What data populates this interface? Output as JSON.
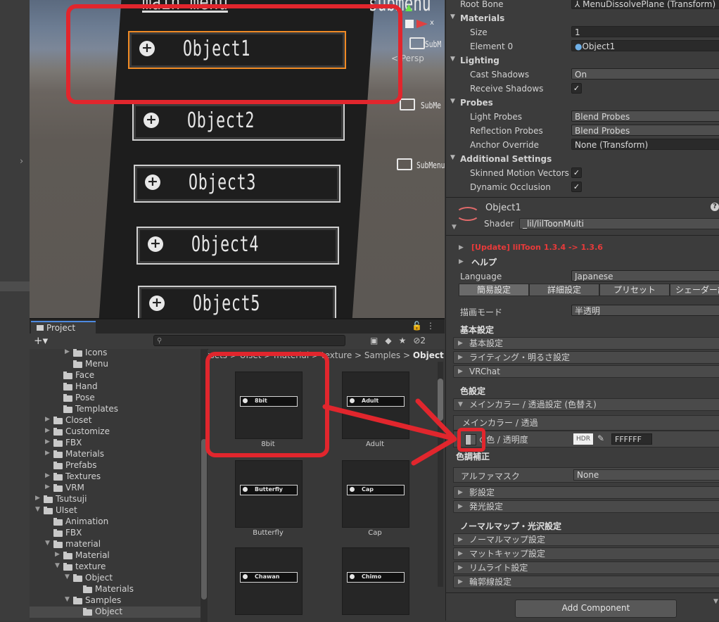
{
  "scene": {
    "menu_title": "main menu",
    "submenu_title": "submenu",
    "persp_label": "< Persp",
    "objects": [
      "Object1",
      "Object2",
      "Object3",
      "Object4",
      "Object5"
    ],
    "submenu_labels": [
      "SubM",
      "SubMe",
      "SubMenu"
    ],
    "gizmo_axis_x": "x"
  },
  "project": {
    "tab_label": "Project",
    "add_label": "+▾",
    "search_placeholder": "",
    "hidden_count": "2",
    "tree": [
      {
        "label": "Icons",
        "indent": 4,
        "expanded": false,
        "hasChild": true
      },
      {
        "label": "Menu",
        "indent": 4,
        "expanded": false,
        "hasChild": false
      },
      {
        "label": "Face",
        "indent": 3,
        "expanded": false,
        "hasChild": false
      },
      {
        "label": "Hand",
        "indent": 3,
        "expanded": false,
        "hasChild": false
      },
      {
        "label": "Pose",
        "indent": 3,
        "expanded": false,
        "hasChild": false
      },
      {
        "label": "Templates",
        "indent": 3,
        "expanded": false,
        "hasChild": false
      },
      {
        "label": "Closet",
        "indent": 2,
        "expanded": false,
        "hasChild": true
      },
      {
        "label": "Customize",
        "indent": 2,
        "expanded": false,
        "hasChild": true
      },
      {
        "label": "FBX",
        "indent": 2,
        "expanded": false,
        "hasChild": true
      },
      {
        "label": "Materials",
        "indent": 2,
        "expanded": false,
        "hasChild": true
      },
      {
        "label": "Prefabs",
        "indent": 2,
        "expanded": false,
        "hasChild": false
      },
      {
        "label": "Textures",
        "indent": 2,
        "expanded": false,
        "hasChild": true
      },
      {
        "label": "VRM",
        "indent": 2,
        "expanded": false,
        "hasChild": true
      },
      {
        "label": "Tsutsuji",
        "indent": 1,
        "expanded": false,
        "hasChild": true
      },
      {
        "label": "UIset",
        "indent": 1,
        "expanded": true,
        "hasChild": true
      },
      {
        "label": "Animation",
        "indent": 2,
        "expanded": false,
        "hasChild": false
      },
      {
        "label": "FBX",
        "indent": 2,
        "expanded": false,
        "hasChild": false
      },
      {
        "label": "material",
        "indent": 2,
        "expanded": true,
        "hasChild": true
      },
      {
        "label": "Material",
        "indent": 3,
        "expanded": false,
        "hasChild": true
      },
      {
        "label": "texture",
        "indent": 3,
        "expanded": true,
        "hasChild": true
      },
      {
        "label": "Object",
        "indent": 4,
        "expanded": true,
        "hasChild": true
      },
      {
        "label": "Materials",
        "indent": 5,
        "expanded": false,
        "hasChild": false
      },
      {
        "label": "Samples",
        "indent": 4,
        "expanded": true,
        "hasChild": true
      },
      {
        "label": "Object",
        "indent": 5,
        "expanded": false,
        "hasChild": false,
        "selected": true
      }
    ],
    "breadcrumb": [
      "Assets",
      "UIset",
      "material",
      "texture",
      "Samples"
    ],
    "breadcrumb_current": "Object",
    "assets": [
      {
        "name": "8bit",
        "bar": "8bit"
      },
      {
        "name": "Adult",
        "bar": "Adult"
      },
      {
        "name": "Butterfly",
        "bar": "Butterfly"
      },
      {
        "name": "Cap",
        "bar": "Cap"
      },
      {
        "name": "",
        "bar": "Chawan"
      },
      {
        "name": "",
        "bar": "Chimo"
      }
    ]
  },
  "inspector": {
    "root_bone": {
      "label": "Root Bone",
      "value": "MenuDissolvePlane (Transform)"
    },
    "materials_header": "Materials",
    "size": {
      "label": "Size",
      "value": "1"
    },
    "element0": {
      "label": "Element 0",
      "value": "Object1"
    },
    "lighting_header": "Lighting",
    "cast_shadows": {
      "label": "Cast Shadows",
      "value": "On"
    },
    "receive_shadows": {
      "label": "Receive Shadows",
      "checked": "✓"
    },
    "probes_header": "Probes",
    "light_probes": {
      "label": "Light Probes",
      "value": "Blend Probes"
    },
    "reflection_probes": {
      "label": "Reflection Probes",
      "value": "Blend Probes"
    },
    "anchor_override": {
      "label": "Anchor Override",
      "value": "None (Transform)"
    },
    "additional_header": "Additional Settings",
    "skinned_motion": {
      "label": "Skinned Motion Vectors",
      "checked": "✓"
    },
    "dynamic_occlusion": {
      "label": "Dynamic Occlusion",
      "checked": "✓"
    },
    "material_name": "Object1",
    "help_icon": "?",
    "shader_label": "Shader",
    "shader_value": "_lil/lilToonMulti",
    "update_notice": "[Update] lilToon 1.3.4 -> 1.3.6",
    "help_label": "ヘルプ",
    "language": {
      "label": "Language",
      "value": "Japanese"
    },
    "tabs": [
      "簡易設定",
      "詳細設定",
      "プリセット",
      "シェーダー設定"
    ],
    "render_mode": {
      "label": "描画モード",
      "value": "半透明"
    },
    "basic_header": "基本設定",
    "basic_items": [
      "基本設定",
      "ライティング・明るさ設定",
      "VRChat"
    ],
    "color_header": "色設定",
    "main_color_fold": "メインカラー / 透過設定 (色替え)",
    "main_color_sub": "メインカラー / 透過",
    "color_alpha": {
      "label": "色 / 透明度",
      "hdr": "HDR",
      "value": "FFFFFF"
    },
    "tone_correction": "色調補正",
    "alpha_mask": {
      "label": "アルファマスク",
      "value": "None"
    },
    "color_items": [
      "影設定",
      "発光設定"
    ],
    "normal_header": "ノーマルマップ・光沢設定",
    "normal_items": [
      "ノーマルマップ設定",
      "マットキャップ設定",
      "リムライト設定",
      "輪郭線設定"
    ],
    "add_component": "Add Component"
  },
  "colors": {
    "highlight_red": "#e1262d",
    "update_red": "#e83a3a",
    "selection_orange": "#f08a24"
  }
}
